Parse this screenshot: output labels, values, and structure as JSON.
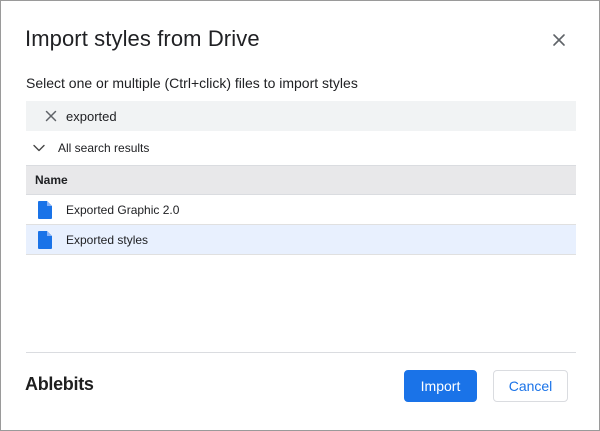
{
  "dialog": {
    "title": "Import styles from Drive",
    "subtitle": "Select one or multiple (Ctrl+click) files to import styles",
    "close_icon": "close-icon"
  },
  "search": {
    "value": "exported",
    "clear_icon": "close-icon"
  },
  "results_toggle": {
    "label": "All search results",
    "icon": "chevron-down-icon"
  },
  "table": {
    "header": "Name",
    "rows": [
      {
        "name": "Exported Graphic 2.0",
        "icon": "doc-file-icon",
        "selected": false
      },
      {
        "name": "Exported styles",
        "icon": "doc-file-icon",
        "selected": true
      }
    ]
  },
  "footer": {
    "brand": "Ablebits",
    "import_label": "Import",
    "cancel_label": "Cancel"
  },
  "colors": {
    "accent": "#1a73e8",
    "selected_row": "#e8f0fe",
    "header_bg": "#e8e8ea",
    "search_bg": "#f1f3f4",
    "file_icon": "#1a73e8"
  }
}
